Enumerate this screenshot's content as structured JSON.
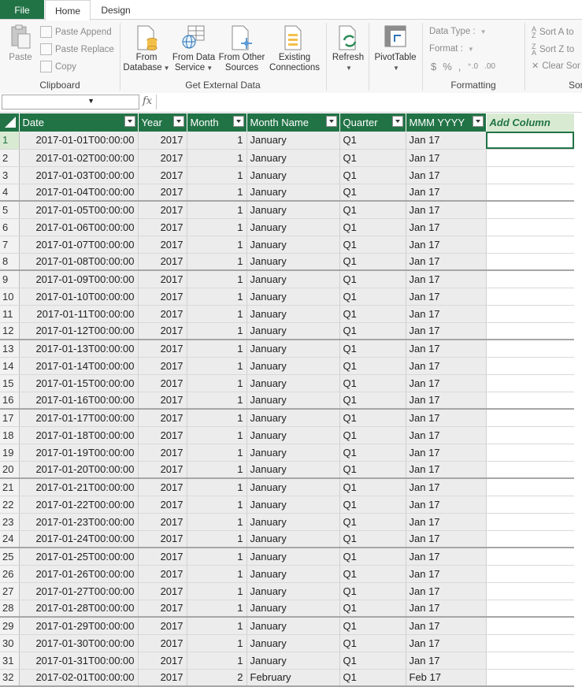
{
  "tabs": {
    "file": "File",
    "home": "Home",
    "design": "Design"
  },
  "ribbon": {
    "clipboard": {
      "paste": "Paste",
      "paste_append": "Paste Append",
      "paste_replace": "Paste Replace",
      "copy": "Copy",
      "label": "Clipboard"
    },
    "external": {
      "from_database": [
        "From",
        "Database"
      ],
      "from_data_service": [
        "From Data",
        "Service"
      ],
      "from_other_sources": [
        "From Other",
        "Sources"
      ],
      "existing_connections": [
        "Existing",
        "Connections"
      ],
      "label": "Get External Data"
    },
    "refresh": "Refresh",
    "pivottable": "PivotTable",
    "formatting": {
      "data_type": "Data Type :",
      "format": "Format :",
      "label": "Formatting"
    },
    "sort": {
      "sort_a_to_z": "Sort A to",
      "sort_z_to_a": "Sort Z to",
      "clear_sort": "Clear Sor",
      "label": "Sor"
    }
  },
  "formula_bar": {
    "name_box": "",
    "fx": "fx",
    "formula": ""
  },
  "table": {
    "columns": [
      "Date",
      "Year",
      "Month",
      "Month Name",
      "Quarter",
      "MMM YYYY"
    ],
    "add_column": "Add Column",
    "rows": [
      [
        "1",
        "2017-01-01T00:00:00",
        "2017",
        "1",
        "January",
        "Q1",
        "Jan 17"
      ],
      [
        "2",
        "2017-01-02T00:00:00",
        "2017",
        "1",
        "January",
        "Q1",
        "Jan 17"
      ],
      [
        "3",
        "2017-01-03T00:00:00",
        "2017",
        "1",
        "January",
        "Q1",
        "Jan 17"
      ],
      [
        "4",
        "2017-01-04T00:00:00",
        "2017",
        "1",
        "January",
        "Q1",
        "Jan 17"
      ],
      [
        "5",
        "2017-01-05T00:00:00",
        "2017",
        "1",
        "January",
        "Q1",
        "Jan 17"
      ],
      [
        "6",
        "2017-01-06T00:00:00",
        "2017",
        "1",
        "January",
        "Q1",
        "Jan 17"
      ],
      [
        "7",
        "2017-01-07T00:00:00",
        "2017",
        "1",
        "January",
        "Q1",
        "Jan 17"
      ],
      [
        "8",
        "2017-01-08T00:00:00",
        "2017",
        "1",
        "January",
        "Q1",
        "Jan 17"
      ],
      [
        "9",
        "2017-01-09T00:00:00",
        "2017",
        "1",
        "January",
        "Q1",
        "Jan 17"
      ],
      [
        "10",
        "2017-01-10T00:00:00",
        "2017",
        "1",
        "January",
        "Q1",
        "Jan 17"
      ],
      [
        "11",
        "2017-01-11T00:00:00",
        "2017",
        "1",
        "January",
        "Q1",
        "Jan 17"
      ],
      [
        "12",
        "2017-01-12T00:00:00",
        "2017",
        "1",
        "January",
        "Q1",
        "Jan 17"
      ],
      [
        "13",
        "2017-01-13T00:00:00",
        "2017",
        "1",
        "January",
        "Q1",
        "Jan 17"
      ],
      [
        "14",
        "2017-01-14T00:00:00",
        "2017",
        "1",
        "January",
        "Q1",
        "Jan 17"
      ],
      [
        "15",
        "2017-01-15T00:00:00",
        "2017",
        "1",
        "January",
        "Q1",
        "Jan 17"
      ],
      [
        "16",
        "2017-01-16T00:00:00",
        "2017",
        "1",
        "January",
        "Q1",
        "Jan 17"
      ],
      [
        "17",
        "2017-01-17T00:00:00",
        "2017",
        "1",
        "January",
        "Q1",
        "Jan 17"
      ],
      [
        "18",
        "2017-01-18T00:00:00",
        "2017",
        "1",
        "January",
        "Q1",
        "Jan 17"
      ],
      [
        "19",
        "2017-01-19T00:00:00",
        "2017",
        "1",
        "January",
        "Q1",
        "Jan 17"
      ],
      [
        "20",
        "2017-01-20T00:00:00",
        "2017",
        "1",
        "January",
        "Q1",
        "Jan 17"
      ],
      [
        "21",
        "2017-01-21T00:00:00",
        "2017",
        "1",
        "January",
        "Q1",
        "Jan 17"
      ],
      [
        "22",
        "2017-01-22T00:00:00",
        "2017",
        "1",
        "January",
        "Q1",
        "Jan 17"
      ],
      [
        "23",
        "2017-01-23T00:00:00",
        "2017",
        "1",
        "January",
        "Q1",
        "Jan 17"
      ],
      [
        "24",
        "2017-01-24T00:00:00",
        "2017",
        "1",
        "January",
        "Q1",
        "Jan 17"
      ],
      [
        "25",
        "2017-01-25T00:00:00",
        "2017",
        "1",
        "January",
        "Q1",
        "Jan 17"
      ],
      [
        "26",
        "2017-01-26T00:00:00",
        "2017",
        "1",
        "January",
        "Q1",
        "Jan 17"
      ],
      [
        "27",
        "2017-01-27T00:00:00",
        "2017",
        "1",
        "January",
        "Q1",
        "Jan 17"
      ],
      [
        "28",
        "2017-01-28T00:00:00",
        "2017",
        "1",
        "January",
        "Q1",
        "Jan 17"
      ],
      [
        "29",
        "2017-01-29T00:00:00",
        "2017",
        "1",
        "January",
        "Q1",
        "Jan 17"
      ],
      [
        "30",
        "2017-01-30T00:00:00",
        "2017",
        "1",
        "January",
        "Q1",
        "Jan 17"
      ],
      [
        "31",
        "2017-01-31T00:00:00",
        "2017",
        "1",
        "January",
        "Q1",
        "Jan 17"
      ],
      [
        "32",
        "2017-02-01T00:00:00",
        "2017",
        "2",
        "February",
        "Q1",
        "Feb 17"
      ]
    ]
  },
  "colors": {
    "accent": "#217346",
    "add_column_bg": "#d9ead3",
    "cell_bg": "#ececec"
  }
}
